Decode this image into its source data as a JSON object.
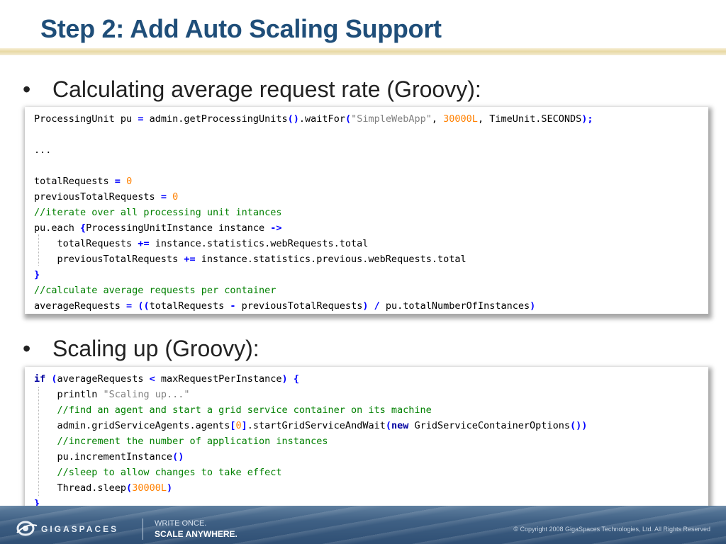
{
  "slide": {
    "title": "Step 2: Add Auto Scaling Support",
    "bullet_symbol": "•",
    "bullets": [
      "Calculating average request rate (Groovy):",
      "Scaling up (Groovy):"
    ]
  },
  "code_blocks": [
    {
      "language": "Groovy",
      "lines": [
        [
          {
            "t": "ProcessingUnit pu ",
            "c": ""
          },
          {
            "t": "=",
            "c": "op"
          },
          {
            "t": " admin.getProcessingUnits",
            "c": ""
          },
          {
            "t": "()",
            "c": "op"
          },
          {
            "t": ".waitFor",
            "c": ""
          },
          {
            "t": "(",
            "c": "op"
          },
          {
            "t": "\"SimpleWebApp\"",
            "c": "str"
          },
          {
            "t": ", ",
            "c": ""
          },
          {
            "t": "30000L",
            "c": "num"
          },
          {
            "t": ", TimeUnit.SECONDS",
            "c": ""
          },
          {
            "t": ");",
            "c": "op"
          }
        ],
        [],
        [
          {
            "t": "...",
            "c": ""
          }
        ],
        [],
        [
          {
            "t": "totalRequests ",
            "c": ""
          },
          {
            "t": "=",
            "c": "op"
          },
          {
            "t": " ",
            "c": ""
          },
          {
            "t": "0",
            "c": "num"
          }
        ],
        [
          {
            "t": "previousTotalRequests ",
            "c": ""
          },
          {
            "t": "=",
            "c": "op"
          },
          {
            "t": " ",
            "c": ""
          },
          {
            "t": "0",
            "c": "num"
          }
        ],
        [
          {
            "t": "//iterate over all processing unit intances",
            "c": "cm"
          }
        ],
        [
          {
            "t": "pu.each ",
            "c": ""
          },
          {
            "t": "{",
            "c": "op"
          },
          {
            "t": "ProcessingUnitInstance instance ",
            "c": ""
          },
          {
            "t": "->",
            "c": "op"
          }
        ],
        [
          {
            "t": "    totalRequests ",
            "c": ""
          },
          {
            "t": "+=",
            "c": "op"
          },
          {
            "t": " instance.statistics.webRequests.total",
            "c": ""
          }
        ],
        [
          {
            "t": "    previousTotalRequests ",
            "c": ""
          },
          {
            "t": "+=",
            "c": "op"
          },
          {
            "t": " instance.statistics.previous.webRequests.total",
            "c": ""
          }
        ],
        [
          {
            "t": "}",
            "c": "op"
          }
        ],
        [
          {
            "t": "//calculate average requests per container",
            "c": "cm"
          }
        ],
        [
          {
            "t": "averageRequests ",
            "c": ""
          },
          {
            "t": "=",
            "c": "op"
          },
          {
            "t": " ",
            "c": ""
          },
          {
            "t": "((",
            "c": "op"
          },
          {
            "t": "totalRequests ",
            "c": ""
          },
          {
            "t": "-",
            "c": "op"
          },
          {
            "t": " previousTotalRequests",
            "c": ""
          },
          {
            "t": ")",
            "c": "op"
          },
          {
            "t": " ",
            "c": ""
          },
          {
            "t": "/",
            "c": "op"
          },
          {
            "t": " pu.totalNumberOfInstances",
            "c": ""
          },
          {
            "t": ")",
            "c": "op"
          }
        ]
      ]
    },
    {
      "language": "Groovy",
      "lines": [
        [
          {
            "t": "if",
            "c": "kw"
          },
          {
            "t": " ",
            "c": ""
          },
          {
            "t": "(",
            "c": "op"
          },
          {
            "t": "averageRequests ",
            "c": ""
          },
          {
            "t": "<",
            "c": "op"
          },
          {
            "t": " maxRequestPerInstance",
            "c": ""
          },
          {
            "t": ")",
            "c": "op"
          },
          {
            "t": " ",
            "c": ""
          },
          {
            "t": "{",
            "c": "op"
          }
        ],
        [
          {
            "t": "    println ",
            "c": ""
          },
          {
            "t": "\"Scaling up...\"",
            "c": "str"
          }
        ],
        [
          {
            "t": "    //find an agent and start a grid service container on its machine",
            "c": "cm"
          }
        ],
        [
          {
            "t": "    admin.gridServiceAgents.agents",
            "c": ""
          },
          {
            "t": "[",
            "c": "op"
          },
          {
            "t": "0",
            "c": "num"
          },
          {
            "t": "]",
            "c": "op"
          },
          {
            "t": ".startGridServiceAndWait",
            "c": ""
          },
          {
            "t": "(",
            "c": "op"
          },
          {
            "t": "new",
            "c": "kw"
          },
          {
            "t": " GridServiceContainerOptions",
            "c": ""
          },
          {
            "t": "())",
            "c": "op"
          }
        ],
        [
          {
            "t": "    //increment the number of application instances",
            "c": "cm"
          }
        ],
        [
          {
            "t": "    pu.incrementInstance",
            "c": ""
          },
          {
            "t": "()",
            "c": "op"
          }
        ],
        [
          {
            "t": "    //sleep to allow changes to take effect",
            "c": "cm"
          }
        ],
        [
          {
            "t": "    Thread.sleep",
            "c": ""
          },
          {
            "t": "(",
            "c": "op"
          },
          {
            "t": "30000L",
            "c": "num"
          },
          {
            "t": ")",
            "c": "op"
          }
        ],
        [
          {
            "t": "}",
            "c": "op"
          }
        ]
      ]
    }
  ],
  "footer": {
    "brand": "GIGASPACES",
    "tagline_1": "WRITE ONCE.",
    "tagline_2": "SCALE ANYWHERE.",
    "copyright": "© Copyright 2008 GigaSpaces Technologies, Ltd. All Rights Reserved",
    "background_color": "#3f6084"
  },
  "colors": {
    "title": "#1f4e79",
    "keyword": "#0000a0",
    "operator": "#0000ff",
    "number": "#ff8000",
    "string": "#808080",
    "comment": "#008000"
  }
}
